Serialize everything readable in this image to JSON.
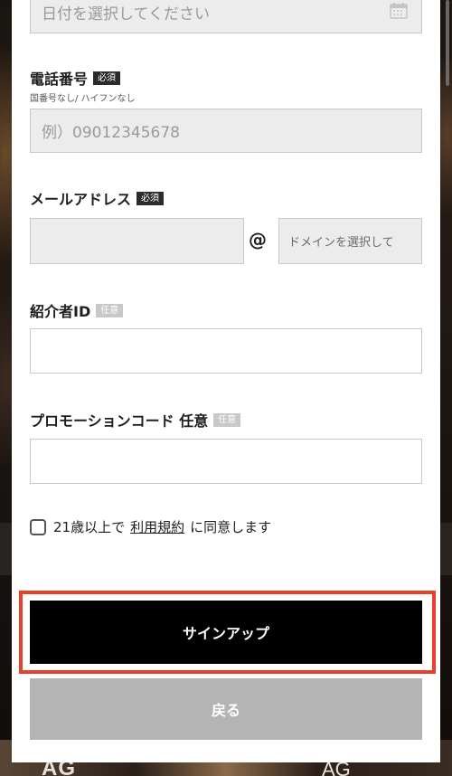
{
  "form": {
    "date": {
      "placeholder": "日付を選択してください",
      "icon": "calendar-icon"
    },
    "phone": {
      "label": "電話番号",
      "badge": "必須",
      "sublabel": "国番号なし/ ハイフンなし",
      "placeholder": "例）09012345678"
    },
    "email": {
      "label": "メールアドレス",
      "badge": "必須",
      "local_value": "",
      "at": "@",
      "domain_placeholder": "ドメインを選択して"
    },
    "referrer": {
      "label": "紹介者ID",
      "badge": "任意",
      "value": ""
    },
    "promo": {
      "label": "プロモーションコード 任意",
      "badge": "任意",
      "value": ""
    },
    "agree": {
      "prefix": "21歳以上で",
      "link": "利用規約",
      "suffix": "に同意します",
      "checked": false
    }
  },
  "buttons": {
    "signup": "サインアップ",
    "back": "戻る"
  },
  "background": {
    "logo_left": "AG",
    "logo_right": "AG"
  },
  "colors": {
    "highlight": "#e8402a",
    "signup_bg": "#000000",
    "back_bg": "#b4b4b4",
    "required_badge": "#2b2b2b",
    "optional_badge": "#c8c8c8"
  }
}
